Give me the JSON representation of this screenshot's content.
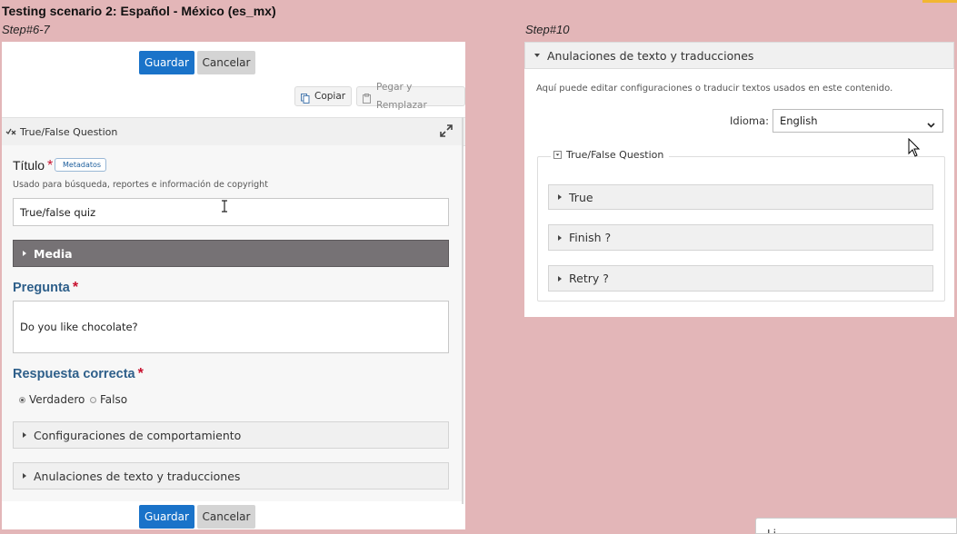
{
  "page": {
    "title": "Testing scenario 2: Español - México (es_mx)",
    "left_step": "Step#6-7",
    "right_step": "Step#10"
  },
  "editor": {
    "save_label": "Guardar",
    "cancel_label": "Cancelar",
    "copy_label": "Copiar",
    "paste_replace_label": "Pegar y Remplazar",
    "library_title": "True/False Question",
    "title_label": "Título",
    "metadata_tag": "Metadatos",
    "title_hint": "Usado para búsqueda, reportes e información de copyright",
    "title_value": "True/false quiz",
    "media_label": "Media",
    "question_label": "Pregunta",
    "question_value": "Do you like chocolate?",
    "correct_answer_label": "Respuesta correcta",
    "option_true": "Verdadero",
    "option_false": "Falso",
    "selected_option": "Verdadero",
    "behaviour_label": "Configuraciones de comportamiento",
    "overrides_label": "Anulaciones de texto y traducciones"
  },
  "overrides_panel": {
    "header": "Anulaciones de texto y traducciones",
    "description": "Aquí puede editar configuraciones o traducir textos usados en este contenido.",
    "language_label": "Idioma:",
    "language_value": "English",
    "group_title": "True/False Question",
    "items": [
      {
        "label": "True"
      },
      {
        "label": "Finish ?"
      },
      {
        "label": "Retry ?"
      }
    ]
  },
  "bottom_right_fragment": "Li",
  "colors": {
    "background": "#e3b6b8",
    "primary_button": "#1a73c9",
    "media_bar": "#767275",
    "required": "#c8102e",
    "section_label": "#2e5f8a"
  }
}
